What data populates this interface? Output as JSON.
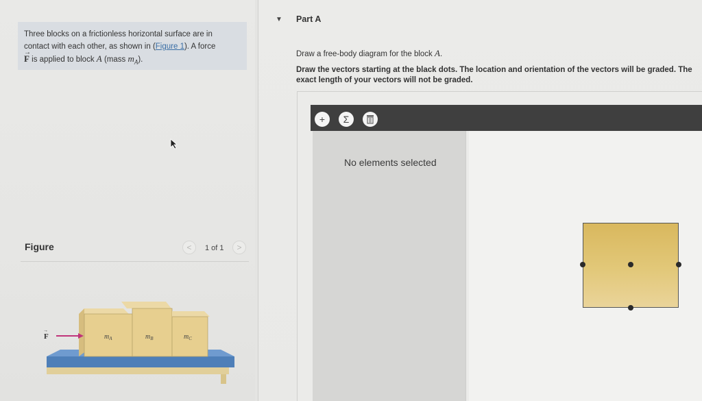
{
  "problem": {
    "line1": "Three blocks on a frictionless horizontal surface are in",
    "line2_pre": "contact with each other, as shown in (",
    "figure_link": "Figure 1",
    "line2_post": "). A force",
    "force_symbol": "F",
    "line3_mid": "is applied to block",
    "block_letter": "A",
    "line3_mass_pre": "(mass",
    "mass_symbol": "m",
    "mass_sub": "A",
    "line3_end": ")."
  },
  "figure": {
    "title": "Figure",
    "page_indicator": "1 of 1",
    "force_label": "F",
    "blocks": [
      {
        "label": "m",
        "sub": "A"
      },
      {
        "label": "m",
        "sub": "B"
      },
      {
        "label": "m",
        "sub": "C"
      }
    ]
  },
  "part": {
    "title": "Part A",
    "instruction_pre": "Draw a free-body diagram for the block",
    "instruction_block": "A",
    "instruction_end": ".",
    "instruction2": "Draw the vectors starting at the black dots. The location and orientation of the vectors will be graded. The exact length of your vectors will not be graded."
  },
  "toolbar": {
    "buttons": [
      {
        "icon": "plus-icon",
        "glyph": "+"
      },
      {
        "icon": "sigma-icon",
        "glyph": "Σ"
      },
      {
        "icon": "trash-icon",
        "glyph": ""
      }
    ]
  },
  "side_panel": {
    "message": "No elements selected"
  },
  "colors": {
    "block_fill": "#e2c879",
    "toolbar_bg": "#3f3f3f",
    "force_arrow": "#c0337a",
    "table_top": "#4e7fb8"
  }
}
